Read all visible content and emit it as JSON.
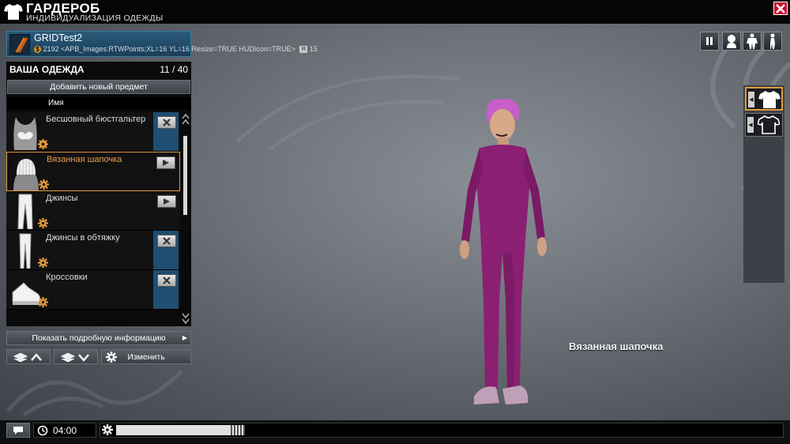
{
  "header": {
    "title": "ГАРДЕРОБ",
    "subtitle": "ИНДИВИДУАЛИЗАЦИЯ ОДЕЖДЫ"
  },
  "player": {
    "name": "GRIDTest2",
    "money_line": "2192 <APB_Images:RTWPoints;XL=16 YL=16 Resize=TRUE HUDIcon=TRUE>",
    "r_value": "15",
    "coin_symbol": "$",
    "r_symbol": "R"
  },
  "wardrobe": {
    "title": "ВАША ОДЕЖДА",
    "count": "11 / 40",
    "add_button": "Добавить новый предмет",
    "column_name": "Имя",
    "items": [
      {
        "label": "Бесшовный бюстгальтер",
        "action": "remove",
        "icon": "bra-icon"
      },
      {
        "label": "Вязанная шапочка",
        "action": "equip",
        "icon": "beanie-icon"
      },
      {
        "label": "Джинсы",
        "action": "equip",
        "icon": "jeans-icon"
      },
      {
        "label": "Джинсы в обтяжку",
        "action": "remove",
        "icon": "skinny-jeans-icon"
      },
      {
        "label": "Кроссовки",
        "action": "remove",
        "icon": "sneakers-icon"
      }
    ],
    "selected_index": 1,
    "info_button": "Показать подробную информацию",
    "edit_button": "Изменить"
  },
  "preview": {
    "item_caption": "Вязанная шапочка"
  },
  "bottom": {
    "time": "04:00",
    "timeline_position": 0.17
  },
  "colors": {
    "accent": "#e39a3a",
    "panel_blue": "#1e4e72",
    "outfit": "#8b1f72"
  }
}
